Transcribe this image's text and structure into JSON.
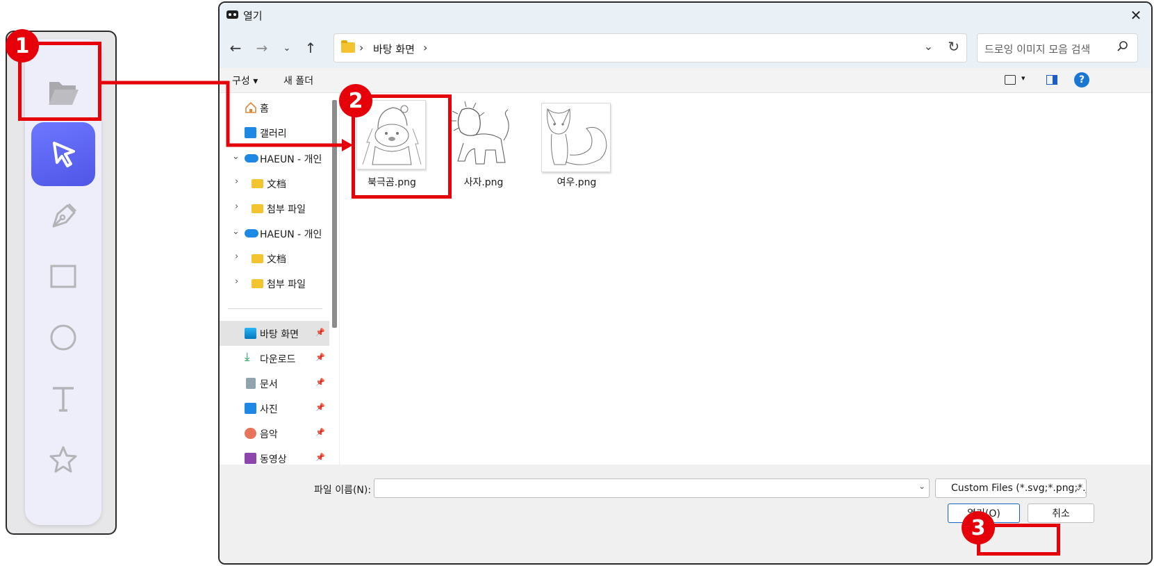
{
  "toolbar": {
    "tools": [
      {
        "name": "open-folder",
        "icon": "folder-open-icon",
        "active": false
      },
      {
        "name": "select",
        "icon": "cursor-arrow-icon",
        "active": true
      },
      {
        "name": "pen",
        "icon": "pen-nib-icon",
        "active": false
      },
      {
        "name": "rectangle",
        "icon": "rectangle-icon",
        "active": false
      },
      {
        "name": "circle",
        "icon": "circle-icon",
        "active": false
      },
      {
        "name": "text",
        "icon": "text-t-icon",
        "active": false
      },
      {
        "name": "star",
        "icon": "star-icon",
        "active": false
      }
    ],
    "active_color": "#5b63f0"
  },
  "dialog": {
    "title": "열기",
    "close": "✕",
    "address": {
      "path": "바탕 화면",
      "sep": "›"
    },
    "search_placeholder": "드로잉 이미지 모음 검색",
    "commands": {
      "organize": "구성 ▾",
      "new_folder": "새 폴더"
    },
    "nav": [
      {
        "label": "홈",
        "icon": "home-icon",
        "pinned": false
      },
      {
        "label": "갤러리",
        "icon": "gallery-icon",
        "pinned": false
      },
      {
        "label": "HAEUN - 개인",
        "icon": "onedrive-cloud-icon",
        "expanded": true
      },
      {
        "label": "文档",
        "icon": "folder-icon"
      },
      {
        "label": "첨부 파일",
        "icon": "folder-icon"
      },
      {
        "label": "HAEUN - 개인",
        "icon": "onedrive-cloud-icon",
        "expanded": true
      },
      {
        "label": "文档",
        "icon": "folder-icon"
      },
      {
        "label": "첨부 파일",
        "icon": "folder-icon"
      },
      {
        "label": "바탕 화면",
        "icon": "desktop-icon",
        "pinned": true,
        "selected": true
      },
      {
        "label": "다운로드",
        "icon": "download-icon",
        "pinned": true
      },
      {
        "label": "문서",
        "icon": "document-icon",
        "pinned": true
      },
      {
        "label": "사진",
        "icon": "pictures-icon",
        "pinned": true
      },
      {
        "label": "음악",
        "icon": "music-icon",
        "pinned": true
      },
      {
        "label": "동영상",
        "icon": "video-icon",
        "pinned": true
      }
    ],
    "files": [
      {
        "name": "북극곰.png",
        "thumb": "polar-bear-drawing"
      },
      {
        "name": "사자.png",
        "thumb": "lion-drawing"
      },
      {
        "name": "여우.png",
        "thumb": "fox-drawing"
      }
    ],
    "filename_label": "파일 이름(N):",
    "filename_value": "",
    "filter_value": "Custom Files (*.svg;*.png;*.jpg;",
    "open_button": "열기(O)",
    "cancel_button": "취소"
  },
  "annotations": {
    "badges": [
      "1",
      "2",
      "3"
    ],
    "color": "#e5000a"
  }
}
